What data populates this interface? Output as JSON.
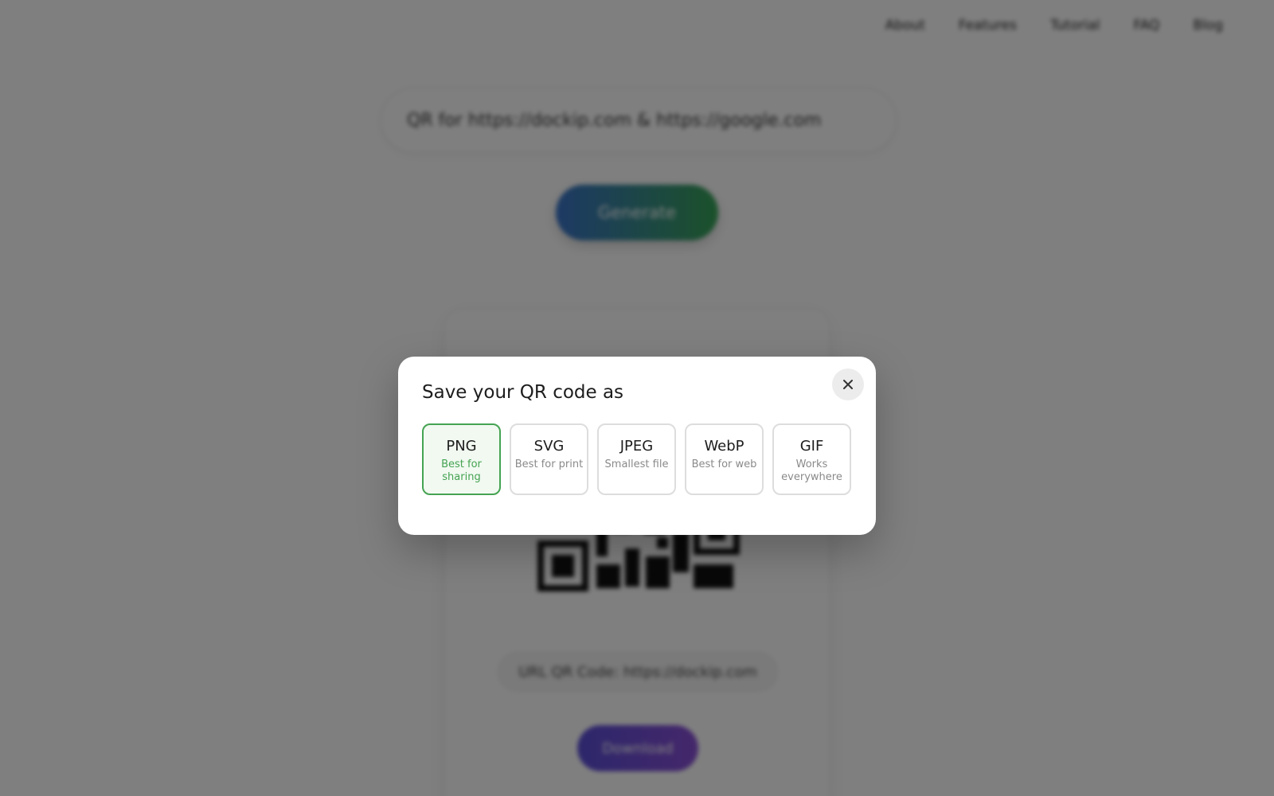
{
  "nav": {
    "items": [
      "About",
      "Features",
      "Tutorial",
      "FAQ",
      "Blog"
    ]
  },
  "prompt": {
    "value": "QR for https://dockip.com & https://google.com"
  },
  "generate": {
    "label": "Generate"
  },
  "result": {
    "url_label": "URL QR Code: https://dockip.com",
    "download_label": "Download"
  },
  "modal": {
    "title": "Save your QR code as",
    "close_icon": "close-icon",
    "formats": [
      {
        "name": "PNG",
        "desc": "Best for sharing",
        "selected": true
      },
      {
        "name": "SVG",
        "desc": "Best for print",
        "selected": false
      },
      {
        "name": "JPEG",
        "desc": "Smallest file",
        "selected": false
      },
      {
        "name": "WebP",
        "desc": "Best for web",
        "selected": false
      },
      {
        "name": "GIF",
        "desc": "Works everywhere",
        "selected": false
      }
    ]
  },
  "colors": {
    "accent_green": "#45a352",
    "generate_gradient": [
      "#3b74c9",
      "#37a356"
    ],
    "download_gradient": [
      "#5a4fd6",
      "#8a4fd6"
    ],
    "overlay": "rgba(0,0,0,0.5)"
  }
}
